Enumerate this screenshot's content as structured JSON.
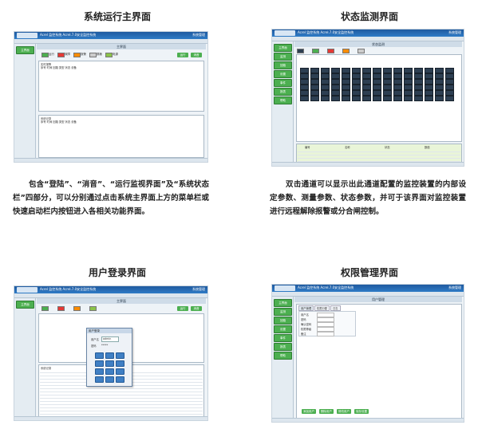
{
  "panels": {
    "main": {
      "title": "系统运行主界面",
      "app_title": "Acrel 监控系统 Acrel.7.0安全监控系统",
      "status": "系统管理",
      "tab": "主界面",
      "sidebar": [
        "主界面"
      ],
      "buttons": [
        "运行",
        "消音"
      ],
      "indicators": [
        {
          "label": "运行",
          "color": "#4caf50"
        },
        {
          "label": "故障",
          "color": "#e53935"
        },
        {
          "label": "报警",
          "color": "#fb8c00"
        },
        {
          "label": "屏蔽",
          "color": "#cccccc"
        },
        {
          "label": "电源",
          "color": "#8bc34a"
        }
      ],
      "upper_box_label": "实时报警",
      "upper_box_cols": "序号 时间 回路 类型 状态 设备",
      "lower_box_label": "系统记录",
      "lower_box_cols": "序号 时间 回路 类型 状态 设备"
    },
    "monitor": {
      "title": "状态监测界面",
      "app_title": "Acrel 监控系统 Acrel.7.0安全监控系统",
      "status": "系统管理",
      "tab": "状态监测",
      "sidebar": [
        "主界面",
        "监测",
        "回路",
        "设置",
        "事件",
        "报表",
        "帮助"
      ],
      "node_rows": 6,
      "node_cols": 15,
      "table_header": [
        "编号",
        "名称",
        "状态",
        "数值"
      ],
      "table_rows": 4
    },
    "login": {
      "title": "用户登录界面",
      "app_title": "Acrel 监控系统 Acrel.7.0安全监控系统",
      "status": "系统管理",
      "tab": "主界面",
      "sidebar": [
        "主界面"
      ],
      "buttons": [
        "运行",
        "消音"
      ],
      "dialog_title": "用户登录",
      "user_label": "用户名",
      "user_value": "admin",
      "pwd_label": "密码",
      "pwd_value": "*****",
      "list_label": "系统记录",
      "list_rows": 14
    },
    "permission": {
      "title": "权限管理界面",
      "app_title": "Acrel 监控系统 Acrel.7.0安全监控系统",
      "status": "系统管理",
      "tab": "用户管理",
      "sidebar": [
        "主界面",
        "监测",
        "回路",
        "设置",
        "事件",
        "报表",
        "帮助"
      ],
      "subtabs": [
        "用户管理",
        "权限分配",
        "日志"
      ],
      "fields": [
        "用户名",
        "密码",
        "确认密码",
        "权限等级",
        "备注"
      ],
      "bottom_buttons": [
        "添加用户",
        "删除用户",
        "修改用户",
        "保存设置"
      ]
    }
  },
  "descriptions": {
    "main": "包含“登陆”、“消音”、“运行监视界面”及“系统状态栏”四部分，可以分别通过点击系统主界面上方的菜单栏或快速启动栏内按钮进入各相关功能界面。",
    "monitor": "双击通道可以显示出此通道配置的监控装置的内部设定参数、测量参数、状态参数，并可于该界面对监控装置进行远程解除报警或分合闸控制。"
  }
}
